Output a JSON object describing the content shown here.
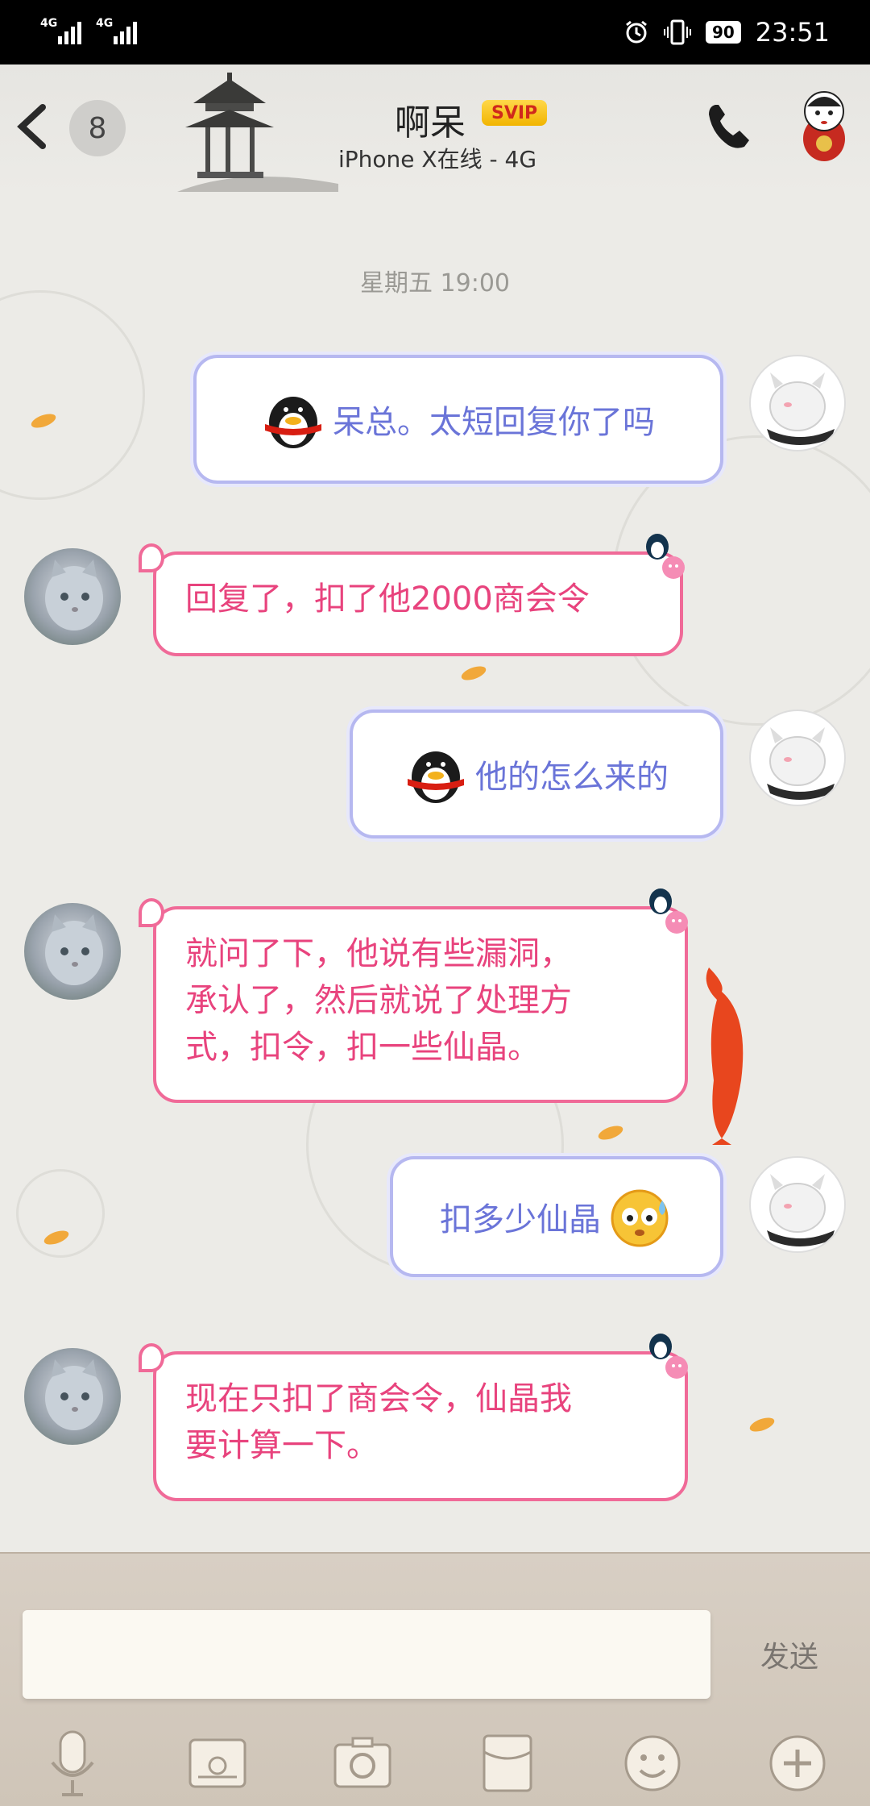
{
  "status_bar": {
    "network_1": "4G",
    "network_2": "4G",
    "battery": "90",
    "time": "23:51"
  },
  "header": {
    "unread_count": "8",
    "contact_name": "啊呆",
    "vip_badge": "SVIP",
    "contact_status": "iPhone X在线 - 4G"
  },
  "chat": {
    "timestamp": "星期五 19:00",
    "messages": [
      {
        "side": "right",
        "text": "呆总。太短回复你了吗",
        "has_emoji": true
      },
      {
        "side": "left",
        "text": "回复了，扣了他2000商会令"
      },
      {
        "side": "right",
        "text": "他的怎么来的",
        "has_emoji": true
      },
      {
        "side": "left",
        "text_lines": [
          "就问了下，他说有些漏洞，",
          "承认了，然后就说了处理方",
          "式，扣令，扣一些仙晶。"
        ]
      },
      {
        "side": "right",
        "text": "扣多少仙晶",
        "has_emoji": true
      },
      {
        "side": "left",
        "text_lines": [
          "现在只扣了商会令，仙晶我",
          "要计算一下。"
        ]
      }
    ]
  },
  "input": {
    "value": "",
    "send_label": "发送"
  },
  "toolbar": {
    "items": [
      "microphone-icon",
      "photo-icon",
      "camera-icon",
      "red-packet-icon",
      "emoji-icon",
      "plus-icon"
    ]
  },
  "colors": {
    "right_bubble_border": "#b6b8f0",
    "right_text": "#6a74d8",
    "left_bubble_border": "#f06a98",
    "left_text": "#e8437d",
    "background": "#ecebe7"
  }
}
